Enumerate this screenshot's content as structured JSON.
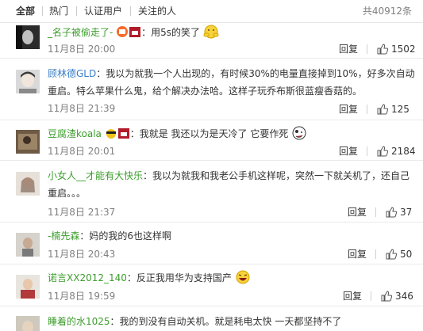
{
  "tabs": [
    {
      "label": "全部",
      "active": true
    },
    {
      "label": "热门",
      "active": false
    },
    {
      "label": "认证用户",
      "active": false
    },
    {
      "label": "关注的人",
      "active": false
    }
  ],
  "total_label": "共40912条",
  "reply_label": "回复",
  "comments": [
    {
      "user": "_名子被偷走了-",
      "text": "：用5s的笑了",
      "time": "11月8日 20:00",
      "likes": "1502"
    },
    {
      "user": "顾林德GLD",
      "text": "：我以为就我一个人出现的，有时候30%的电量直接掉到10%，好多次自动重启。特么苹果什么鬼，给个解决办法哈。这样子玩乔布斯很蓝瘦香菇的。",
      "time": "11月8日 21:39",
      "likes": "125"
    },
    {
      "user": "豆腐渣koala",
      "text": "：我就是 我还以为是天冷了 它要作死",
      "time": "11月8日 20:01",
      "likes": "2184"
    },
    {
      "user": "小女人__才能有大快乐",
      "text": "：我以为就我和我老公手机这样呢，突然一下就关机了，还自己重启。。。",
      "time": "11月8日 21:37",
      "likes": "37"
    },
    {
      "user": "-楠先森",
      "text": "：妈的我的6也这样啊",
      "time": "11月8日 20:43",
      "likes": "50"
    },
    {
      "user": "诺言XX2012_140",
      "text": "：反正我用华为支持国产",
      "time": "11月8日 19:59",
      "likes": "346"
    },
    {
      "user": "睡着的水1025",
      "text": "：我的到没有自动关机。就是耗电太快 一天都坚持不了",
      "time": "",
      "likes": ""
    }
  ],
  "colors": {
    "username_orange": "#eb7350",
    "username_green": "#3c9d2c",
    "username_blue": "#3b7ec7",
    "meta_gray": "#808080"
  }
}
